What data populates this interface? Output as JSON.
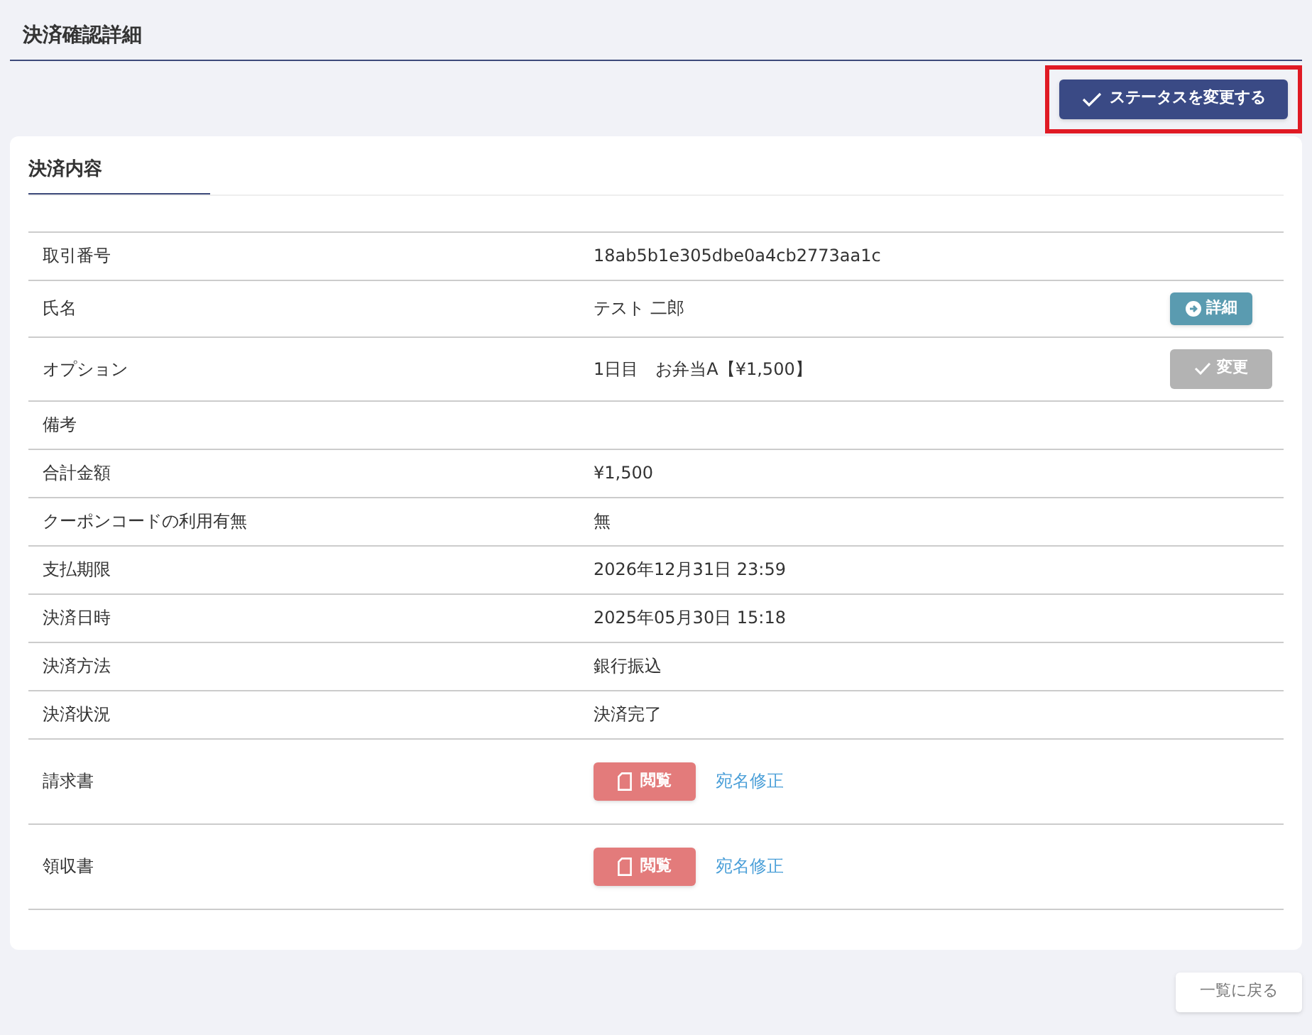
{
  "page_title": "決済確認詳細",
  "status_button": {
    "label": "ステータスを変更する",
    "highlighted": true
  },
  "section": {
    "title": "決済内容"
  },
  "rows": [
    {
      "kind": "text",
      "label": "取引番号",
      "value": "18ab5b1e305dbe0a4cb2773aa1c"
    },
    {
      "kind": "action",
      "label": "氏名",
      "value": "テスト 二郎",
      "button": {
        "label": "詳細",
        "disabled": false
      }
    },
    {
      "kind": "action",
      "label": "オプション",
      "value": "1日目　お弁当A【¥1,500】",
      "button": {
        "label": "変更",
        "disabled": true
      }
    },
    {
      "kind": "text",
      "label": "備考"
    },
    {
      "kind": "text",
      "label": "合計金額",
      "value": "¥1,500"
    },
    {
      "kind": "text",
      "label": "クーポンコードの利用有無",
      "value": "無"
    },
    {
      "kind": "text",
      "label": "支払期限",
      "value": "2026年12月31日 23:59"
    },
    {
      "kind": "text",
      "label": "決済日時",
      "value": "2025年05月30日 15:18"
    },
    {
      "kind": "text",
      "label": "決済方法",
      "value": "銀行振込"
    },
    {
      "kind": "text",
      "label": "決済状況",
      "value": "決済完了"
    },
    {
      "kind": "document",
      "label": "請求書",
      "view": "閲覧",
      "link": "宛名修正"
    },
    {
      "kind": "document",
      "label": "領収書",
      "view": "閲覧",
      "link": "宛名修正"
    }
  ],
  "back_button": {
    "label": "一覧に戻る"
  }
}
